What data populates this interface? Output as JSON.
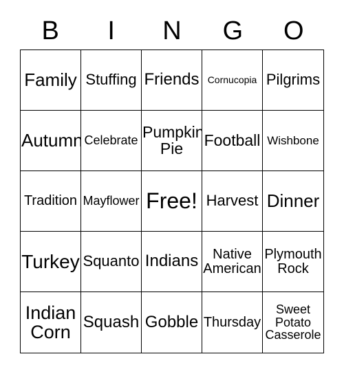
{
  "card": {
    "title": "BINGO",
    "background_color": "#ffffff",
    "text_color": "#000000",
    "border_color": "#000000"
  },
  "header": {
    "letters": [
      {
        "label": "B"
      },
      {
        "label": "I"
      },
      {
        "label": "N"
      },
      {
        "label": "G"
      },
      {
        "label": "O"
      }
    ]
  },
  "grid": {
    "columns": 5,
    "rows": 5,
    "cells": [
      {
        "label": "Family",
        "size": "fs-26",
        "free": false
      },
      {
        "label": "Stuffing",
        "size": "fs-22",
        "free": false
      },
      {
        "label": "Friends",
        "size": "fs-24",
        "free": false
      },
      {
        "label": "Cornucopia",
        "size": "fs-14",
        "free": false
      },
      {
        "label": "Pilgrims",
        "size": "fs-22",
        "free": false
      },
      {
        "label": "Autumn",
        "size": "fs-26",
        "free": false
      },
      {
        "label": "Celebrate",
        "size": "fs-18",
        "free": false
      },
      {
        "label": "Pumpkin\nPie",
        "size": "fs-23",
        "free": false
      },
      {
        "label": "Football",
        "size": "fs-23",
        "free": false
      },
      {
        "label": "Wishbone",
        "size": "fs-17",
        "free": false
      },
      {
        "label": "Tradition",
        "size": "fs-20",
        "free": false
      },
      {
        "label": "Mayflower",
        "size": "fs-18",
        "free": false
      },
      {
        "label": "Free!",
        "size": "fs-32",
        "free": true
      },
      {
        "label": "Harvest",
        "size": "fs-22",
        "free": false
      },
      {
        "label": "Dinner",
        "size": "fs-26",
        "free": false
      },
      {
        "label": "Turkey",
        "size": "fs-28",
        "free": false
      },
      {
        "label": "Squanto",
        "size": "fs-22",
        "free": false
      },
      {
        "label": "Indians",
        "size": "fs-24",
        "free": false
      },
      {
        "label": "Native\nAmerican",
        "size": "fs-20",
        "free": false
      },
      {
        "label": "Plymouth\nRock",
        "size": "fs-20",
        "free": false
      },
      {
        "label": "Indian\nCorn",
        "size": "fs-27",
        "free": false
      },
      {
        "label": "Squash",
        "size": "fs-24",
        "free": false
      },
      {
        "label": "Gobble",
        "size": "fs-24",
        "free": false
      },
      {
        "label": "Thursday",
        "size": "fs-20",
        "free": false
      },
      {
        "label": "Sweet\nPotato\nCasserole",
        "size": "fs-18",
        "free": false
      }
    ]
  }
}
